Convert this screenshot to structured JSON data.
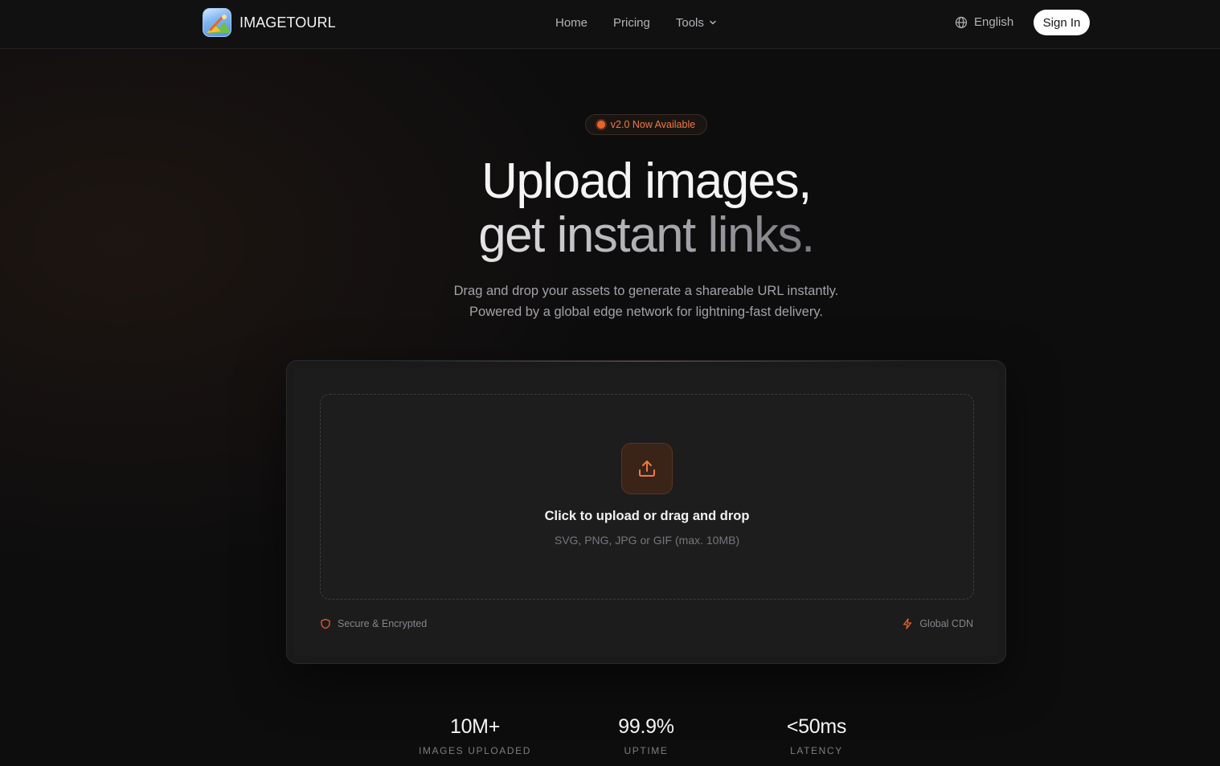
{
  "header": {
    "brand": "IMAGETOURL",
    "nav": [
      "Home",
      "Pricing",
      "Tools"
    ],
    "language": "English",
    "sign_in": "Sign In"
  },
  "hero": {
    "badge": "v2.0 Now Available",
    "title_line1": "Upload images,",
    "title_line2": "get instant links.",
    "subtitle_line1": "Drag and drop your assets to generate a shareable URL instantly.",
    "subtitle_line2": "Powered by a global edge network for lightning-fast delivery."
  },
  "upload": {
    "title": "Click to upload or drag and drop",
    "subtitle": "SVG, PNG, JPG or GIF (max. 10MB)",
    "footer_left": "Secure & Encrypted",
    "footer_right": "Global CDN"
  },
  "stats": [
    {
      "value": "10M+",
      "label": "IMAGES UPLOADED"
    },
    {
      "value": "99.9%",
      "label": "UPTIME"
    },
    {
      "value": "<50ms",
      "label": "LATENCY"
    }
  ],
  "colors": {
    "accent": "#e8642a",
    "background": "#0d0d0e",
    "card": "#1a1a1b"
  },
  "icons": {
    "logo": "brand-logo-icon",
    "tools_chevron": "chevron-down-icon",
    "language": "globe-icon",
    "upload": "upload-icon",
    "secure": "shield-icon",
    "cdn": "lightning-icon"
  }
}
